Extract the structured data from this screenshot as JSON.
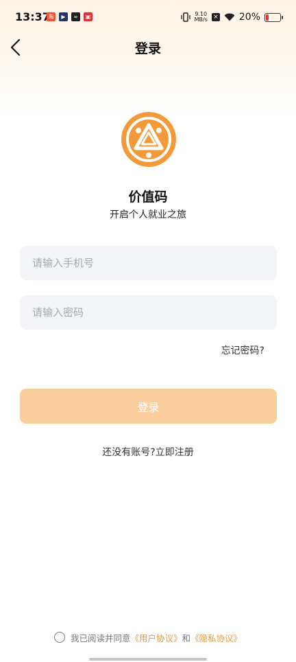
{
  "status_bar": {
    "time": "13:37",
    "network_speed_value": "9.10",
    "network_speed_unit": "MB/s",
    "battery_percent": "20%",
    "battery_level": 0.2,
    "notification_icons": [
      "taobao-icon",
      "video-app-icon",
      "link-app-icon",
      "app-icon"
    ]
  },
  "header": {
    "title": "登录"
  },
  "app": {
    "name": "价值码",
    "slogan": "开启个人就业之旅"
  },
  "form": {
    "phone_placeholder": "请输入手机号",
    "phone_value": "",
    "password_placeholder": "请输入密码",
    "password_value": "",
    "forgot_password": "忘记密码?",
    "login_button": "登录",
    "register_prompt": "还没有账号?立即注册"
  },
  "agreement": {
    "checked": false,
    "prefix": "我已阅读并同意",
    "user_agreement": "《用户协议》",
    "conjunction": "和",
    "privacy_policy": "《隐私协议》"
  },
  "colors": {
    "accent": "#f29a3a",
    "button_disabled": "#facd9c",
    "link": "#e89a3f",
    "input_bg": "#f3f4f8"
  }
}
